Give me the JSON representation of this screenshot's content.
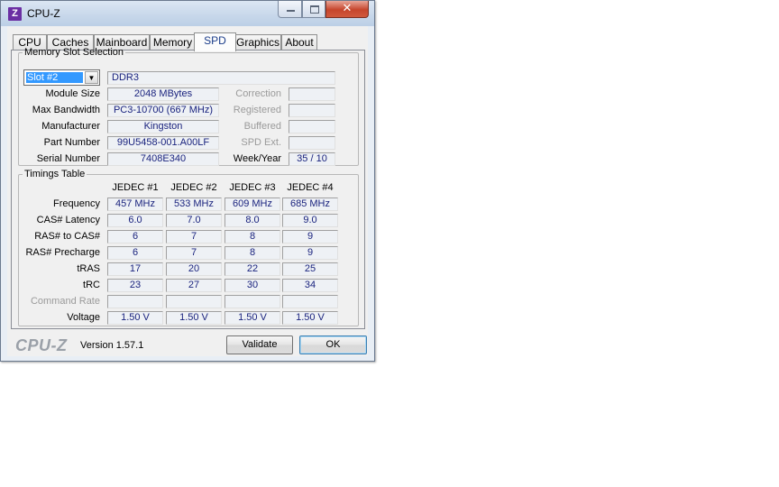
{
  "window": {
    "title": "CPU-Z",
    "app_icon": "Z",
    "icon_color": "#6b2fa3",
    "controls": {
      "minimize": "minimize-icon",
      "maximize": "maximize-icon",
      "close": "✕"
    }
  },
  "tabs": [
    {
      "label": "CPU",
      "active": false
    },
    {
      "label": "Caches",
      "active": false
    },
    {
      "label": "Mainboard",
      "active": false
    },
    {
      "label": "Memory",
      "active": false
    },
    {
      "label": "SPD",
      "active": true
    },
    {
      "label": "Graphics",
      "active": false
    },
    {
      "label": "About",
      "active": false
    }
  ],
  "memory_slot": {
    "legend": "Memory Slot Selection",
    "slot_selected": "Slot #2",
    "memory_type": "DDR3",
    "left_fields": [
      {
        "label": "Module Size",
        "value": "2048 MBytes"
      },
      {
        "label": "Max Bandwidth",
        "value": "PC3-10700 (667 MHz)"
      },
      {
        "label": "Manufacturer",
        "value": "Kingston"
      },
      {
        "label": "Part Number",
        "value": "99U5458-001.A00LF"
      },
      {
        "label": "Serial Number",
        "value": "7408E340"
      }
    ],
    "right_fields": [
      {
        "label": "Correction",
        "value": "",
        "dim": true
      },
      {
        "label": "Registered",
        "value": "",
        "dim": true
      },
      {
        "label": "Buffered",
        "value": "",
        "dim": true
      },
      {
        "label": "SPD Ext.",
        "value": "",
        "dim": true
      },
      {
        "label": "Week/Year",
        "value": "35 / 10",
        "dim": false
      }
    ]
  },
  "timings": {
    "legend": "Timings Table",
    "columns": [
      "JEDEC #1",
      "JEDEC #2",
      "JEDEC #3",
      "JEDEC #4"
    ],
    "rows": [
      {
        "label": "Frequency",
        "dim": false,
        "values": [
          "457 MHz",
          "533 MHz",
          "609 MHz",
          "685 MHz"
        ]
      },
      {
        "label": "CAS# Latency",
        "dim": false,
        "values": [
          "6.0",
          "7.0",
          "8.0",
          "9.0"
        ]
      },
      {
        "label": "RAS# to CAS#",
        "dim": false,
        "values": [
          "6",
          "7",
          "8",
          "9"
        ]
      },
      {
        "label": "RAS# Precharge",
        "dim": false,
        "values": [
          "6",
          "7",
          "8",
          "9"
        ]
      },
      {
        "label": "tRAS",
        "dim": false,
        "values": [
          "17",
          "20",
          "22",
          "25"
        ]
      },
      {
        "label": "tRC",
        "dim": false,
        "values": [
          "23",
          "27",
          "30",
          "34"
        ]
      },
      {
        "label": "Command Rate",
        "dim": true,
        "values": [
          "",
          "",
          "",
          ""
        ]
      },
      {
        "label": "Voltage",
        "dim": false,
        "values": [
          "1.50 V",
          "1.50 V",
          "1.50 V",
          "1.50 V"
        ]
      }
    ]
  },
  "footer": {
    "brand": "CPU-Z",
    "version": "Version 1.57.1",
    "validate_label": "Validate",
    "ok_label": "OK"
  }
}
